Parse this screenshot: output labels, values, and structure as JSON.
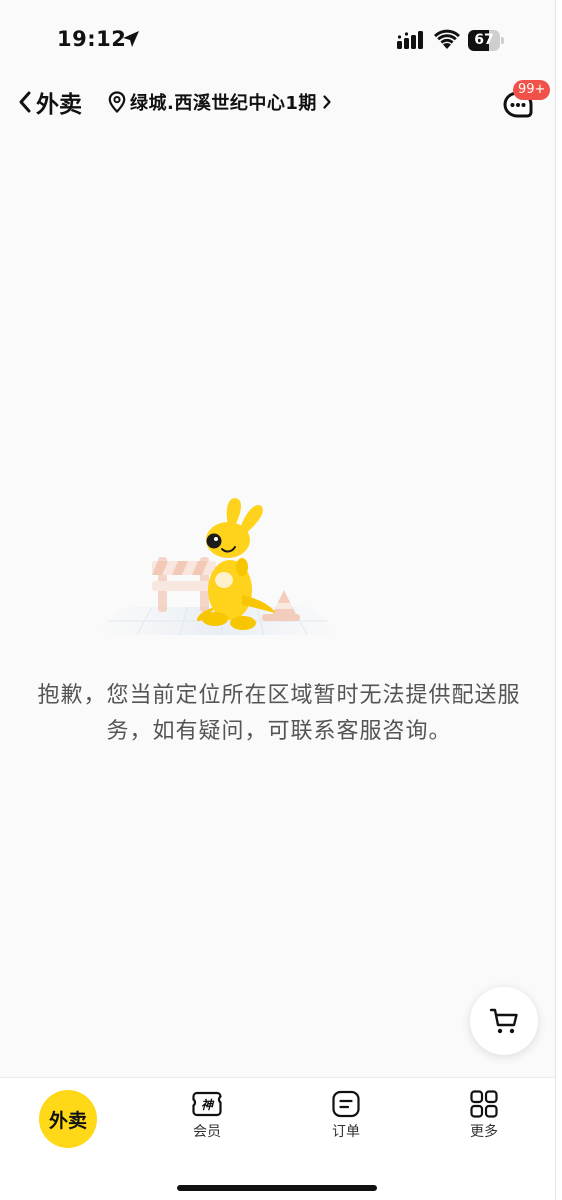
{
  "status_bar": {
    "time": "19:12",
    "battery": "67",
    "battery_level": 0.67
  },
  "nav": {
    "back_label": "外卖",
    "address": "绿城.西溪世纪中心1期",
    "message_badge": "99+"
  },
  "empty_state": {
    "message": "抱歉，您当前定位所在区域暂时无法提供配送服务，如有疑问，可联系客服咨询。"
  },
  "tab_bar": {
    "tabs": [
      {
        "label": "外卖",
        "icon": "takeout-icon",
        "active": true
      },
      {
        "label": "会员",
        "icon": "member-icon",
        "active": false
      },
      {
        "label": "订单",
        "icon": "order-icon",
        "active": false
      },
      {
        "label": "更多",
        "icon": "grid-icon",
        "active": false
      }
    ]
  },
  "colors": {
    "brand_yellow": "#ffd818",
    "badge_red": "#f0524a",
    "text_gray": "#555555"
  }
}
